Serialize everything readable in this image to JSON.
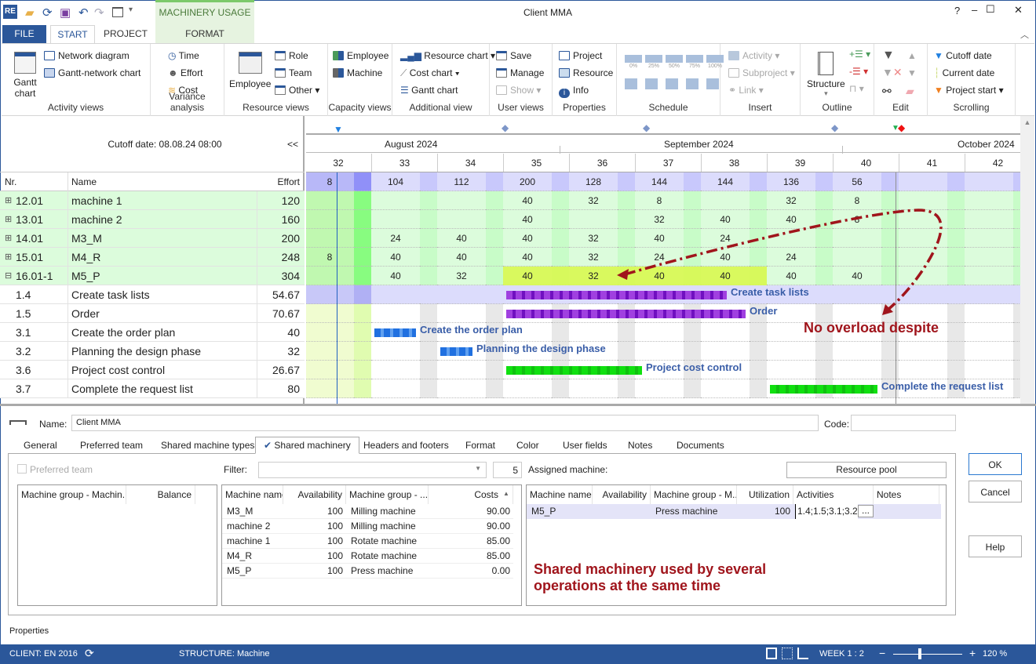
{
  "window": {
    "title": "Client MMA",
    "context_tab": "MACHINERY USAGE",
    "controls": [
      "–",
      "☐",
      "✕"
    ]
  },
  "tabs": {
    "file": "FILE",
    "start": "START",
    "project": "PROJECT",
    "format": "FORMAT"
  },
  "ribbon": {
    "activity_views": {
      "label": "Activity views",
      "gantt": "Gantt chart",
      "network": "Network diagram",
      "gantt_network": "Gantt-network chart"
    },
    "variance": {
      "label": "Variance analysis",
      "time": "Time",
      "effort": "Effort",
      "cost": "Cost"
    },
    "resource_views": {
      "label": "Resource views",
      "employee": "Employee",
      "role": "Role",
      "team": "Team",
      "other": "Other"
    },
    "capacity": {
      "label": "Capacity views",
      "employee": "Employee",
      "machine": "Machine"
    },
    "additional": {
      "label": "Additional view",
      "resource_chart": "Resource chart",
      "cost_chart": "Cost chart",
      "gantt_chart": "Gantt chart"
    },
    "user_views": {
      "label": "User views",
      "save": "Save",
      "manage": "Manage",
      "show": "Show"
    },
    "properties": {
      "label": "Properties",
      "project": "Project",
      "resource": "Resource",
      "info": "Info"
    },
    "schedule": {
      "label": "Schedule",
      "pcts": [
        "0%",
        "25%",
        "50%",
        "75%",
        "100%"
      ]
    },
    "insert": {
      "label": "Insert",
      "activity": "Activity",
      "subproject": "Subproject",
      "link": "Link"
    },
    "outline": {
      "label": "Outline",
      "structure": "Structure"
    },
    "edit": {
      "label": "Edit"
    },
    "scrolling": {
      "label": "Scrolling",
      "cutoff": "Cutoff date",
      "current": "Current date",
      "project_start": "Project start"
    }
  },
  "gantt": {
    "cutoff_label": "Cutoff date: 08.08.24 08:00",
    "collapse": "<<",
    "columns": {
      "nr": "Nr.",
      "name": "Name",
      "effort": "Effort"
    },
    "months": [
      "August 2024",
      "September 2024",
      "October 2024"
    ],
    "weeks": [
      "32",
      "33",
      "34",
      "35",
      "36",
      "37",
      "38",
      "39",
      "40",
      "41",
      "42"
    ],
    "summary": [
      "8",
      "104",
      "112",
      "200",
      "128",
      "144",
      "144",
      "136",
      "56",
      "",
      ""
    ],
    "rows": [
      {
        "nr": "12.01",
        "name": "machine 1",
        "effort": "120",
        "expand": "⊞",
        "values": [
          "",
          "",
          "",
          "40",
          "32",
          "8",
          "",
          "32",
          "8",
          "",
          ""
        ]
      },
      {
        "nr": "13.01",
        "name": "machine 2",
        "effort": "160",
        "expand": "⊞",
        "values": [
          "",
          "",
          "",
          "40",
          "",
          "32",
          "40",
          "40",
          "8",
          "",
          ""
        ]
      },
      {
        "nr": "14.01",
        "name": "M3_M",
        "effort": "200",
        "expand": "⊞",
        "values": [
          "",
          "24",
          "40",
          "40",
          "32",
          "40",
          "24",
          "",
          "",
          "",
          ""
        ]
      },
      {
        "nr": "15.01",
        "name": "M4_R",
        "effort": "248",
        "expand": "⊞",
        "values": [
          "8",
          "40",
          "40",
          "40",
          "32",
          "24",
          "40",
          "24",
          "",
          "",
          ""
        ]
      },
      {
        "nr": "16.01-1",
        "name": "M5_P",
        "effort": "304",
        "expand": "⊟",
        "values": [
          "",
          "40",
          "32",
          "40",
          "32",
          "40",
          "40",
          "40",
          "40",
          "",
          ""
        ]
      },
      {
        "nr": "1.4",
        "name": "Create task lists",
        "effort": "54.67",
        "bar": "Create task lists"
      },
      {
        "nr": "1.5",
        "name": "Order",
        "effort": "70.67",
        "bar": "Order"
      },
      {
        "nr": "3.1",
        "name": "Create the order plan",
        "effort": "40",
        "bar": "Create the order plan"
      },
      {
        "nr": "3.2",
        "name": "Planning the design phase",
        "effort": "32",
        "bar": "Planning the design phase"
      },
      {
        "nr": "3.6",
        "name": "Project cost control",
        "effort": "26.67",
        "bar": "Project cost control"
      },
      {
        "nr": "3.7",
        "name": "Complete the request list",
        "effort": "80",
        "bar": "Complete the request list"
      }
    ],
    "annotation": "No overload despite"
  },
  "props": {
    "name_label": "Name:",
    "name_value": "Client MMA",
    "code_label": "Code:",
    "code_value": "",
    "tabs": [
      "General",
      "Preferred team",
      "Shared machine types",
      "Shared machinery",
      "Headers and footers",
      "Format",
      "Color",
      "User fields",
      "Notes",
      "Documents"
    ],
    "active_tab": "Shared machinery",
    "preferred_team": "Preferred team",
    "filter_label": "Filter:",
    "filter_value": "",
    "count": "5",
    "assigned_label": "Assigned machine:",
    "resource_pool": "Resource pool",
    "left_grid": {
      "headers": [
        "Machine group - Machin...",
        "Balance"
      ]
    },
    "mid_grid": {
      "headers": [
        "Machine name",
        "Availability",
        "Machine group - ...",
        "Costs"
      ],
      "rows": [
        [
          "M3_M",
          "100",
          "Milling machine",
          "90.00"
        ],
        [
          "machine 2",
          "100",
          "Milling machine",
          "90.00"
        ],
        [
          "machine 1",
          "100",
          "Rotate machine",
          "85.00"
        ],
        [
          "M4_R",
          "100",
          "Rotate machine",
          "85.00"
        ],
        [
          "M5_P",
          "100",
          "Press machine",
          "0.00"
        ]
      ]
    },
    "right_grid": {
      "headers": [
        "Machine name",
        "Availability",
        "Machine group - M...",
        "Utilization",
        "Activities",
        "Notes"
      ],
      "rows": [
        [
          "M5_P",
          "",
          "Press machine",
          "100",
          "1.4;1.5;3.1;3.2;3",
          ""
        ]
      ]
    },
    "annotation": "Shared machinery used by several operations at the same time",
    "ok": "OK",
    "cancel": "Cancel",
    "help": "Help",
    "ellipsis": "...",
    "properties_label": "Properties"
  },
  "status": {
    "client": "CLIENT: EN 2016",
    "structure": "STRUCTURE: Machine",
    "scale": "WEEK 1 : 2",
    "zoom": "120 %",
    "zoom_level": 120
  },
  "colors": {
    "brand": "#2b579a",
    "annotation": "#a0151c",
    "bar_label": "#3a5ea8",
    "purple_bar": "#a040e0",
    "blue_bar": "#2070e0",
    "green_bar": "#10e010",
    "overload_highlight": "#d8f850"
  }
}
